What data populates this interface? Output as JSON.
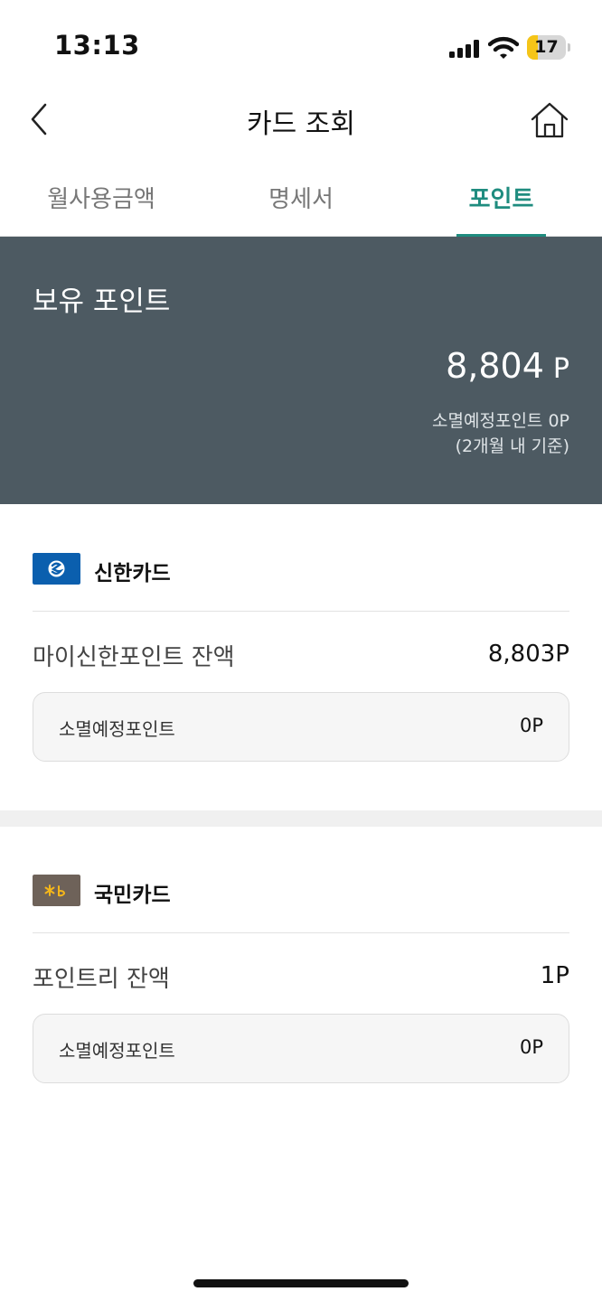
{
  "status": {
    "time": "13:13",
    "battery_level": "17",
    "battery_fraction": 0.17
  },
  "header": {
    "title": "카드 조회"
  },
  "tabs": [
    {
      "label": "월사용금액",
      "active": false
    },
    {
      "label": "명세서",
      "active": false
    },
    {
      "label": "포인트",
      "active": true
    }
  ],
  "summary": {
    "title": "보유 포인트",
    "amount": "8,804",
    "unit": "P",
    "expiring": "소멸예정포인트 0P",
    "basis": "(2개월 내 기준)"
  },
  "cards": [
    {
      "name": "신한카드",
      "logo_color": "#0b5fae",
      "balance_label": "마이신한포인트 잔액",
      "balance_value": "8,803P",
      "expire_label": "소멸예정포인트",
      "expire_value": "0P"
    },
    {
      "name": "국민카드",
      "logo_color": "#6e6259",
      "balance_label": "포인트리 잔액",
      "balance_value": "1P",
      "expire_label": "소멸예정포인트",
      "expire_value": "0P"
    }
  ],
  "colors": {
    "accent": "#1f8c7f",
    "summary_bg": "#4d5a62"
  }
}
